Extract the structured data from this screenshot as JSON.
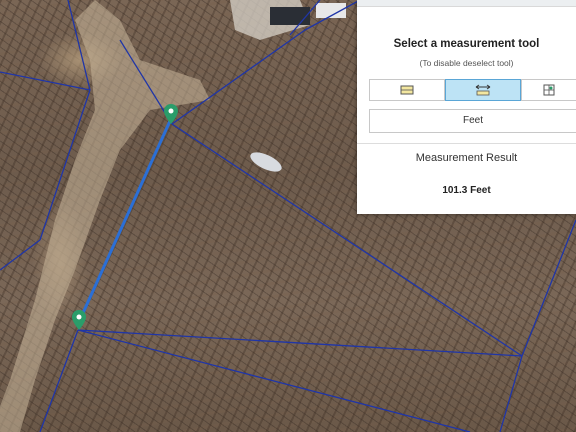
{
  "panel": {
    "title": "Select a measurement tool",
    "hint": "(To disable deselect tool)",
    "tools": [
      {
        "name": "area-tool",
        "active": false
      },
      {
        "name": "distance-tool",
        "active": true
      },
      {
        "name": "location-tool",
        "active": false
      }
    ],
    "unit": "Feet",
    "result_label": "Measurement Result",
    "result_value": "101.3 Feet"
  },
  "map": {
    "parcel_line_color": "#1f35a8",
    "measure_line_color": "#2b6fd6",
    "marker_color": "#2a9d6a"
  }
}
